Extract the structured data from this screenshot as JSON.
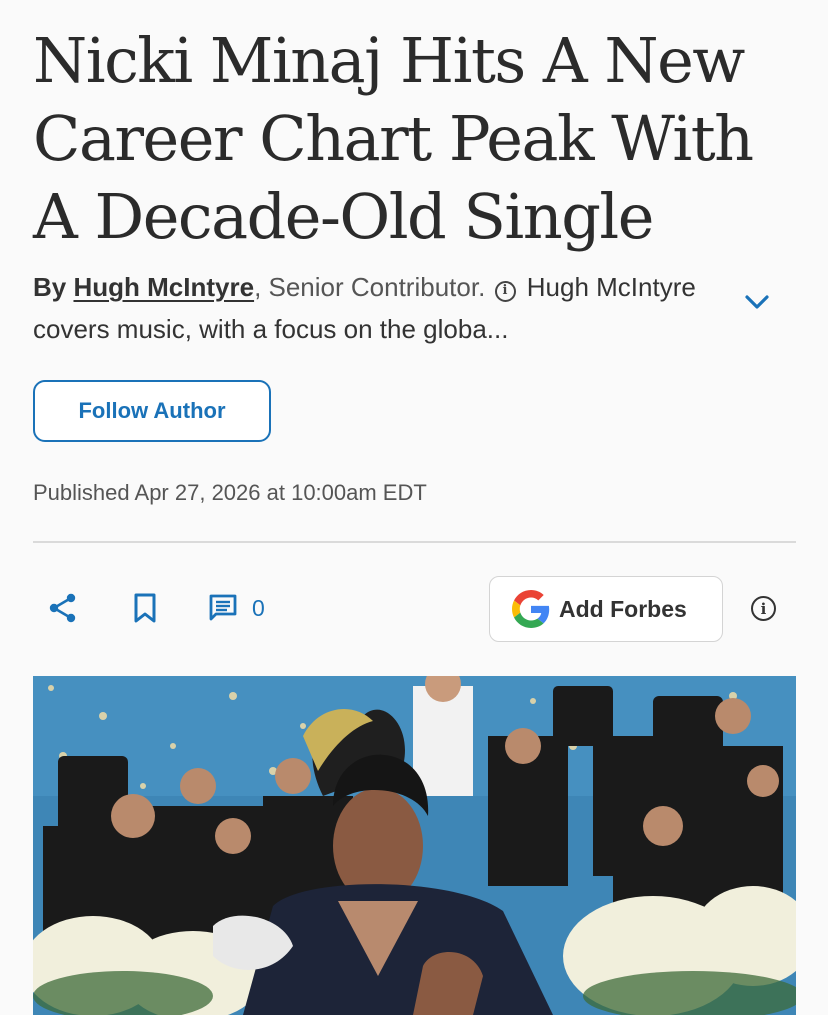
{
  "article": {
    "headline": "Nicki Minaj Hits A New Career Chart Peak With A Decade-Old Single",
    "byline": {
      "prefix": "By",
      "author": "Hugh McIntyre",
      "role": ", Senior Contributor.",
      "bio": "Hugh McIntyre covers music, with a focus on the globa..."
    },
    "follow_label": "Follow Author",
    "published": "Published Apr 27, 2026 at 10:00am EDT"
  },
  "actions": {
    "comment_count": "0",
    "add_forbes_label": "Add Forbes",
    "share_icon": "share-icon",
    "bookmark_icon": "bookmark-icon",
    "comment_icon": "comment-icon",
    "info_icon": "info-icon"
  },
  "colors": {
    "accent": "#1a72b8",
    "text": "#333333",
    "background": "#fafafa",
    "divider": "#dadada",
    "backdrop_blue": "#3e86b6"
  }
}
